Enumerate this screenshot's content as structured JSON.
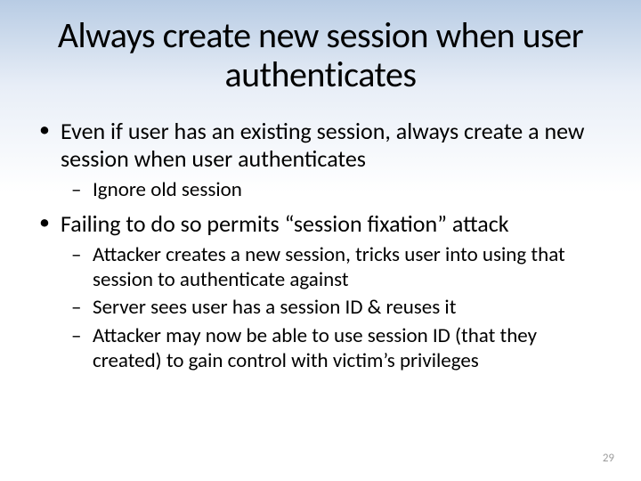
{
  "title": "Always create new session when user authenticates",
  "bullets": [
    {
      "text": "Even if user has an existing session, always create a new session when user authenticates",
      "sub": [
        {
          "text": "Ignore old session"
        }
      ]
    },
    {
      "text": "Failing to do so permits “session fixation” attack",
      "sub": [
        {
          "text": "Attacker creates a new session, tricks user into using that session to authenticate against"
        },
        {
          "text": "Server sees user has a session ID & reuses it"
        },
        {
          "text": "Attacker may now be able to use session ID (that they created) to gain control with victim’s privileges"
        }
      ]
    }
  ],
  "page_number": "29"
}
